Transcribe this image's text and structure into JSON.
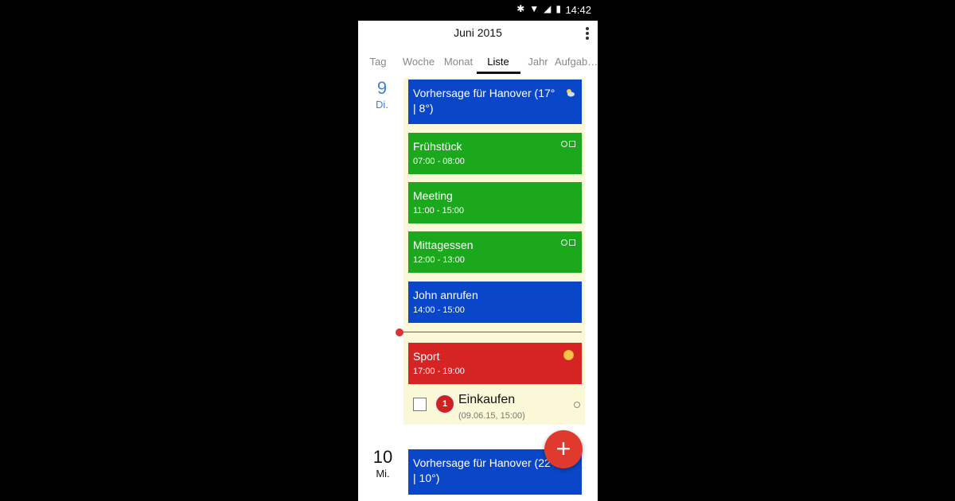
{
  "status_bar": {
    "time": "14:42",
    "icons": [
      "bluetooth-icon",
      "wifi-icon",
      "signal-icon",
      "battery-icon"
    ]
  },
  "header": {
    "title": "Juni 2015",
    "menu_icon": "more-vert-icon"
  },
  "tabs": [
    {
      "label": "Tag",
      "active": false
    },
    {
      "label": "Woche",
      "active": false
    },
    {
      "label": "Monat",
      "active": false
    },
    {
      "label": "Liste",
      "active": true
    },
    {
      "label": "Jahr",
      "active": false
    },
    {
      "label": "Aufgab…",
      "active": false
    }
  ],
  "days": [
    {
      "number": "9",
      "weekday": "Di.",
      "color": "#3b82d6",
      "events": [
        {
          "title": "Vorhersage für Hanover (17° | 8°)",
          "time": "",
          "color": "#0a47c8",
          "icon": "weather-icon"
        },
        {
          "title": "Frühstück",
          "time": "07:00 - 08:00",
          "color": "#1ca81c",
          "icon": "reminder-repeat-icons"
        },
        {
          "title": "Meeting",
          "time": "11:00 - 15:00",
          "color": "#1ca81c",
          "icon": ""
        },
        {
          "title": "Mittagessen",
          "time": "12:00 - 13:00",
          "color": "#1ca81c",
          "icon": "reminder-repeat-icons"
        },
        {
          "title": "John anrufen",
          "time": "14:00 - 15:00",
          "color": "#0a47c8",
          "icon": ""
        },
        {
          "title": "Sport",
          "time": "17:00 - 19:00",
          "color": "#d62424",
          "icon": "coin-icon"
        }
      ],
      "task": {
        "title": "Einkaufen",
        "subtitle": "(09.06.15, 15:00)",
        "priority": "1"
      }
    },
    {
      "number": "10",
      "weekday": "Mi.",
      "color": "#111111",
      "events": [
        {
          "title": "Vorhersage für Hanover (22° | 10°)",
          "time": "",
          "color": "#0a47c8",
          "icon": "weather-icon"
        }
      ]
    }
  ],
  "fab": {
    "label": "+"
  }
}
